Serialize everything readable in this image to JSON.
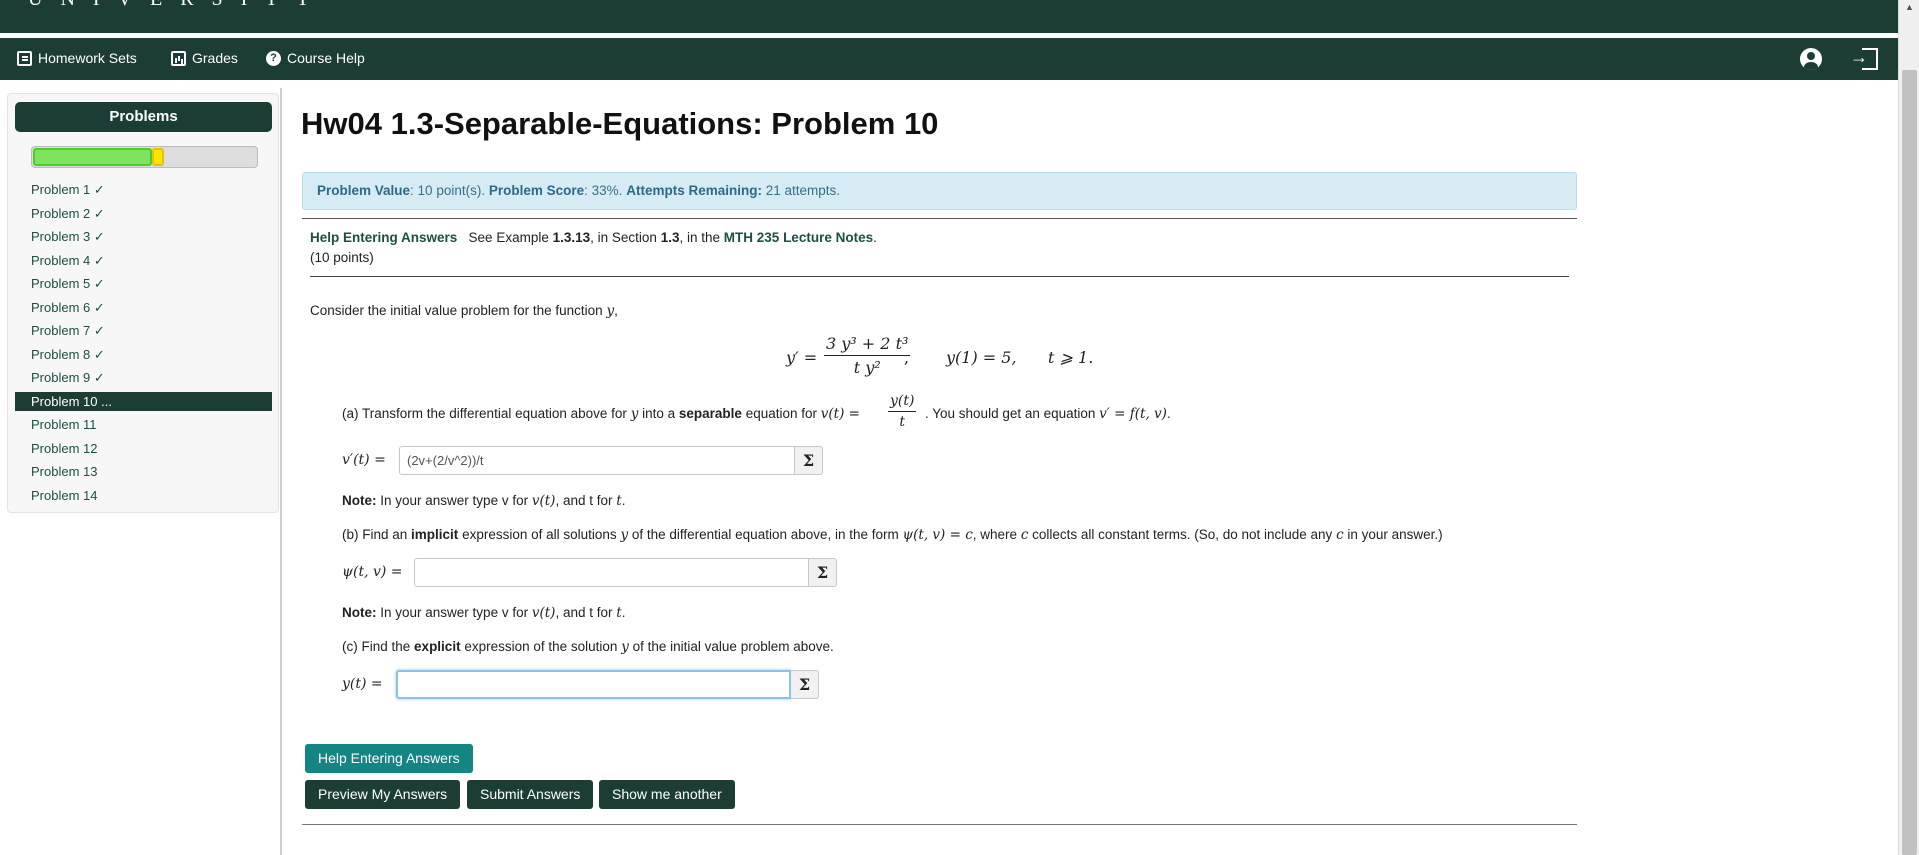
{
  "banner": {
    "brand": "UNIVERSITY"
  },
  "nav": {
    "homework_sets": "Homework Sets",
    "grades": "Grades",
    "course_help": "Course Help",
    "course_help_glyph": "?"
  },
  "sidebar": {
    "title": "Problems",
    "progress": {
      "correct_fraction": 0.53,
      "partial_fraction": 0.055
    },
    "problems": [
      "Problem 1 ✓",
      "Problem 2 ✓",
      "Problem 3 ✓",
      "Problem 4 ✓",
      "Problem 5 ✓",
      "Problem 6 ✓",
      "Problem 7 ✓",
      "Problem 8 ✓",
      "Problem 9 ✓",
      "Problem 10 ...",
      "Problem 11",
      "Problem 12",
      "Problem 13",
      "Problem 14"
    ],
    "active_index": 9
  },
  "main": {
    "title": "Hw04 1.3-Separable-Equations: Problem 10",
    "alert": {
      "value_label": "Problem Value",
      "value_text": ": 10 point(s).",
      "score_label": "Problem Score",
      "score_text": ": 33%.",
      "attempts_label": "Attempts Remaining:",
      "attempts_text": "21 attempts."
    },
    "help": {
      "link": "Help Entering Answers",
      "see": "See Example",
      "example": "1.3.13",
      "in_section": ", in Section",
      "section": "1.3",
      "in_the": ", in the",
      "notes": "MTH 235 Lecture Notes",
      "period": ".",
      "points": "(10 points)"
    },
    "intro": "Consider the initial value problem for the function",
    "intro_var": "y",
    "intro_end": ",",
    "equation": {
      "lhs": "y′ =",
      "num": "3 y³ + 2 t³",
      "den": "t y²",
      "comma": ",",
      "ic": "y(1) = 5,",
      "domain": "t ⩾ 1."
    },
    "part_a": {
      "pre": "(a) Transform the differential equation above for",
      "var_y": "y",
      "mid": "into a",
      "bold": "separable",
      "mid2": "equation for",
      "vt": "v(t) =",
      "frac_num": "y(t)",
      "frac_den": "t",
      "post": ". You should get an equation",
      "eq": "v′ = f(t, v)",
      "end": ".",
      "label": "v′(t) =",
      "value": "(2v+(2/v^2))/t"
    },
    "note_prefix": "Note:",
    "note_text1": "In your answer type v for",
    "note_vt": "v(t)",
    "note_text2": ", and t for",
    "note_t": "t",
    "note_end": ".",
    "part_b": {
      "pre": "(b) Find an",
      "bold": "implicit",
      "mid": "expression of all solutions",
      "var_y": "y",
      "mid2": "of the differential equation above, in the form",
      "form": "ψ(t, v) = c",
      "mid3": ", where",
      "c": "c",
      "post": "collects all constant terms. (So, do not include any",
      "c2": "c",
      "end": "in your answer.)",
      "label": "ψ(t, v) =",
      "value": ""
    },
    "part_c": {
      "pre": "(c) Find the",
      "bold": "explicit",
      "mid": "expression of the solution",
      "var_y": "y",
      "post": "of the initial value problem above.",
      "label": "y(t) =",
      "value": ""
    },
    "sigma": "Σ",
    "buttons": {
      "help": "Help Entering Answers",
      "preview": "Preview My Answers",
      "submit": "Submit Answers",
      "another": "Show me another"
    }
  }
}
